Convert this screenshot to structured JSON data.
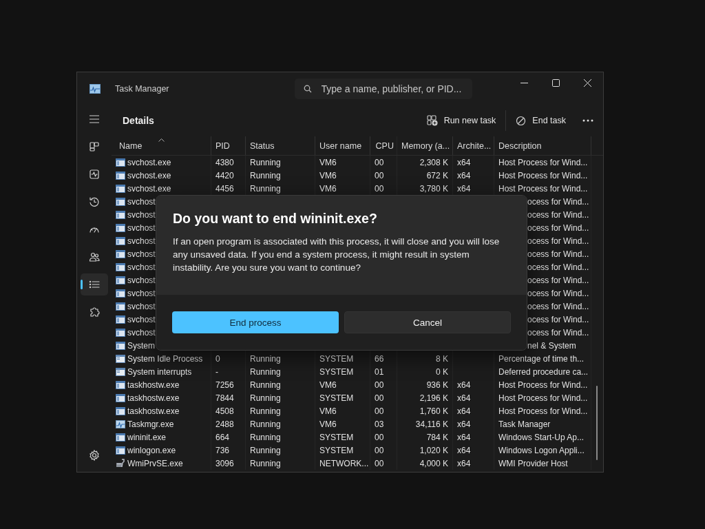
{
  "window": {
    "title": "Task Manager",
    "search": {
      "placeholder": "Type a name, publisher, or PID..."
    }
  },
  "sidebar": {
    "items": [
      {
        "selected": false
      },
      {
        "selected": false
      },
      {
        "selected": false
      },
      {
        "selected": false
      },
      {
        "selected": false
      },
      {
        "selected": true
      },
      {
        "selected": false
      }
    ]
  },
  "page": {
    "title": "Details",
    "actions": [
      {
        "label": "Run new task"
      },
      {
        "label": "End task"
      }
    ]
  },
  "table": {
    "columns": [
      {
        "label": "Name",
        "sorted": true
      },
      {
        "label": "PID",
        "sorted": false
      },
      {
        "label": "Status",
        "sorted": false
      },
      {
        "label": "User name",
        "sorted": false
      },
      {
        "label": "CPU",
        "sorted": false
      },
      {
        "label": "Memory (a...",
        "sorted": false
      },
      {
        "label": "Archite...",
        "sorted": false
      },
      {
        "label": "Description",
        "sorted": false
      }
    ],
    "rows": [
      {
        "kind": "window",
        "covered": false,
        "cells": [
          "svchost.exe",
          "4380",
          "Running",
          "VM6",
          "00",
          "2,308 K",
          "x64",
          "Host Process for Wind..."
        ]
      },
      {
        "kind": "window",
        "covered": false,
        "cells": [
          "svchost.exe",
          "4420",
          "Running",
          "VM6",
          "00",
          "672 K",
          "x64",
          "Host Process for Wind..."
        ]
      },
      {
        "kind": "window",
        "covered": false,
        "cells": [
          "svchost.exe",
          "4456",
          "Running",
          "VM6",
          "00",
          "3,780 K",
          "x64",
          "Host Process for Wind..."
        ]
      },
      {
        "kind": "window",
        "covered": true,
        "cells": [
          "svchost",
          "ocess for Wind..."
        ]
      },
      {
        "kind": "window",
        "covered": true,
        "cells": [
          "svchost",
          "ocess for Wind..."
        ]
      },
      {
        "kind": "window",
        "covered": true,
        "cells": [
          "svchost",
          "ocess for Wind..."
        ]
      },
      {
        "kind": "window",
        "covered": true,
        "cells": [
          "svchost",
          "ocess for Wind..."
        ]
      },
      {
        "kind": "window",
        "covered": true,
        "cells": [
          "svchost",
          "ocess for Wind..."
        ]
      },
      {
        "kind": "window",
        "covered": true,
        "cells": [
          "svchost",
          "ocess for Wind..."
        ]
      },
      {
        "kind": "window",
        "covered": true,
        "cells": [
          "svchost",
          "ocess for Wind..."
        ]
      },
      {
        "kind": "window",
        "covered": true,
        "cells": [
          "svchost",
          "ocess for Wind..."
        ]
      },
      {
        "kind": "window",
        "covered": true,
        "cells": [
          "svchost",
          "ocess for Wind..."
        ]
      },
      {
        "kind": "window",
        "covered": true,
        "cells": [
          "svchost",
          "ocess for Wind..."
        ]
      },
      {
        "kind": "window",
        "covered": true,
        "cells": [
          "svchost",
          "ocess for Wind..."
        ]
      },
      {
        "kind": "window",
        "covered": true,
        "cells": [
          "System",
          "nel & System"
        ]
      },
      {
        "kind": "plain",
        "covered": false,
        "cells": [
          "System Idle Process",
          "0",
          "Running",
          "SYSTEM",
          "66",
          "8 K",
          "",
          "Percentage of time th..."
        ]
      },
      {
        "kind": "plain",
        "covered": false,
        "cells": [
          "System interrupts",
          "-",
          "Running",
          "SYSTEM",
          "01",
          "0 K",
          "",
          "Deferred procedure ca..."
        ]
      },
      {
        "kind": "window",
        "covered": false,
        "cells": [
          "taskhostw.exe",
          "7256",
          "Running",
          "VM6",
          "00",
          "936 K",
          "x64",
          "Host Process for Wind..."
        ]
      },
      {
        "kind": "window",
        "covered": false,
        "cells": [
          "taskhostw.exe",
          "7844",
          "Running",
          "SYSTEM",
          "00",
          "2,196 K",
          "x64",
          "Host Process for Wind..."
        ]
      },
      {
        "kind": "window",
        "covered": false,
        "cells": [
          "taskhostw.exe",
          "4508",
          "Running",
          "VM6",
          "00",
          "1,760 K",
          "x64",
          "Host Process for Wind..."
        ]
      },
      {
        "kind": "chart",
        "covered": false,
        "cells": [
          "Taskmgr.exe",
          "2488",
          "Running",
          "VM6",
          "03",
          "34,116 K",
          "x64",
          "Task Manager"
        ]
      },
      {
        "kind": "window",
        "covered": false,
        "cells": [
          "wininit.exe",
          "664",
          "Running",
          "SYSTEM",
          "00",
          "784 K",
          "x64",
          "Windows Start-Up Ap..."
        ]
      },
      {
        "kind": "window",
        "covered": false,
        "cells": [
          "winlogon.exe",
          "736",
          "Running",
          "SYSTEM",
          "00",
          "1,020 K",
          "x64",
          "Windows Logon Appli..."
        ]
      },
      {
        "kind": "tool",
        "covered": false,
        "cells": [
          "WmiPrvSE.exe",
          "3096",
          "Running",
          "NETWORK...",
          "00",
          "4,000 K",
          "x64",
          "WMI Provider Host"
        ]
      }
    ]
  },
  "dialog": {
    "title": "Do you want to end wininit.exe?",
    "message": "If an open program is associated with this process, it will close and you will lose any unsaved data. If you end a system process, it might result in system instability. Are you sure you want to continue?",
    "buttons": [
      {
        "label": "End process",
        "primary": true
      },
      {
        "label": "Cancel",
        "primary": false
      }
    ]
  }
}
